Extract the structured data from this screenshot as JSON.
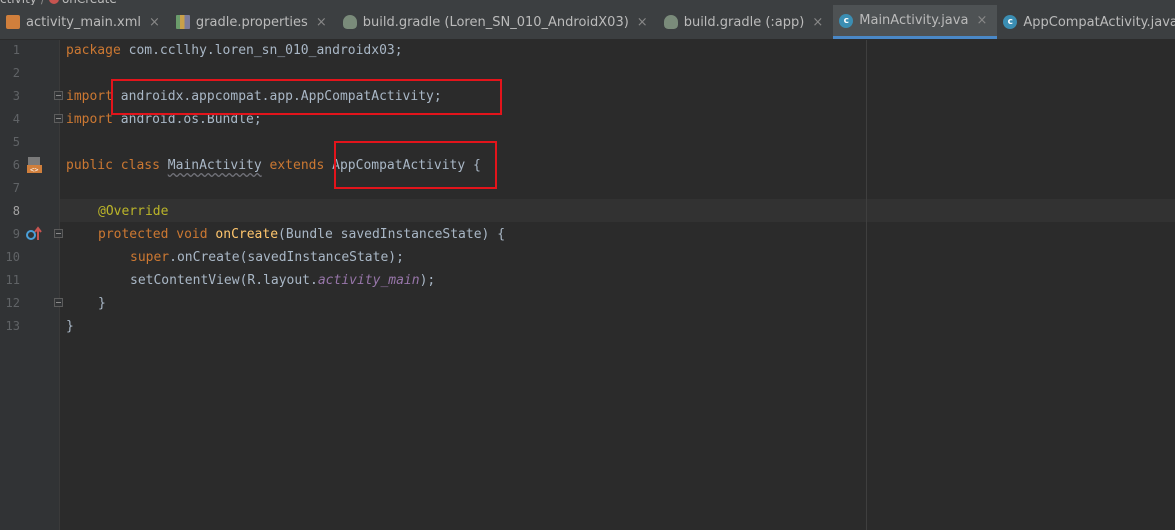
{
  "breadcrumb": {
    "first": "ctivity",
    "separator": "/",
    "second": "onCreate"
  },
  "tabs": [
    {
      "label": "activity_main.xml",
      "icon": "xml-file-icon",
      "close": "×",
      "active": false
    },
    {
      "label": "gradle.properties",
      "icon": "properties-file-icon",
      "close": "×",
      "active": false
    },
    {
      "label": "build.gradle (Loren_SN_010_AndroidX03)",
      "icon": "gradle-icon",
      "close": "×",
      "active": false
    },
    {
      "label": "build.gradle (:app)",
      "icon": "gradle-icon",
      "close": "×",
      "active": false
    },
    {
      "label": "MainActivity.java",
      "icon": "java-class-icon",
      "close": "×",
      "active": true
    },
    {
      "label": "AppCompatActivity.java",
      "icon": "java-class-icon",
      "close": "×",
      "active": false
    }
  ],
  "line_numbers": [
    "1",
    "2",
    "3",
    "4",
    "5",
    "6",
    "7",
    "8",
    "9",
    "10",
    "11",
    "12",
    "13"
  ],
  "code": {
    "l1_kw": "package",
    "l1_rest": " com.ccllhy.loren_sn_010_androidx03;",
    "l3_kw": "import",
    "l3_rest": " androidx.appcompat.app.AppCompatActivity;",
    "l4_kw": "import",
    "l4_rest": " android.os.Bundle;",
    "l6_kw1": "public",
    "l6_kw2": "class",
    "l6_name": "MainActivity",
    "l6_kw3": "extends",
    "l6_rest": " AppCompatActivity {",
    "l8_ann": "@Override",
    "l9_kw1": "protected",
    "l9_kw2": "void",
    "l9_fn": "onCreate",
    "l9_rest": "(Bundle savedInstanceState) {",
    "l10_kw": "super",
    "l10_rest": ".onCreate(savedInstanceState);",
    "l11_a": "setContentView(R.layout.",
    "l11_fld": "activity_main",
    "l11_b": ");",
    "l12": "}",
    "l13": "}"
  },
  "colors": {
    "editor_bg": "#2b2b2b",
    "gutter_bg": "#313335",
    "keyword": "#cc7832",
    "annotation": "#bbb529",
    "method": "#ffc66d",
    "field": "#9876aa",
    "text": "#a9b7c6",
    "highlight_box": "#e3141b",
    "active_tab_underline": "#4a88c7"
  }
}
